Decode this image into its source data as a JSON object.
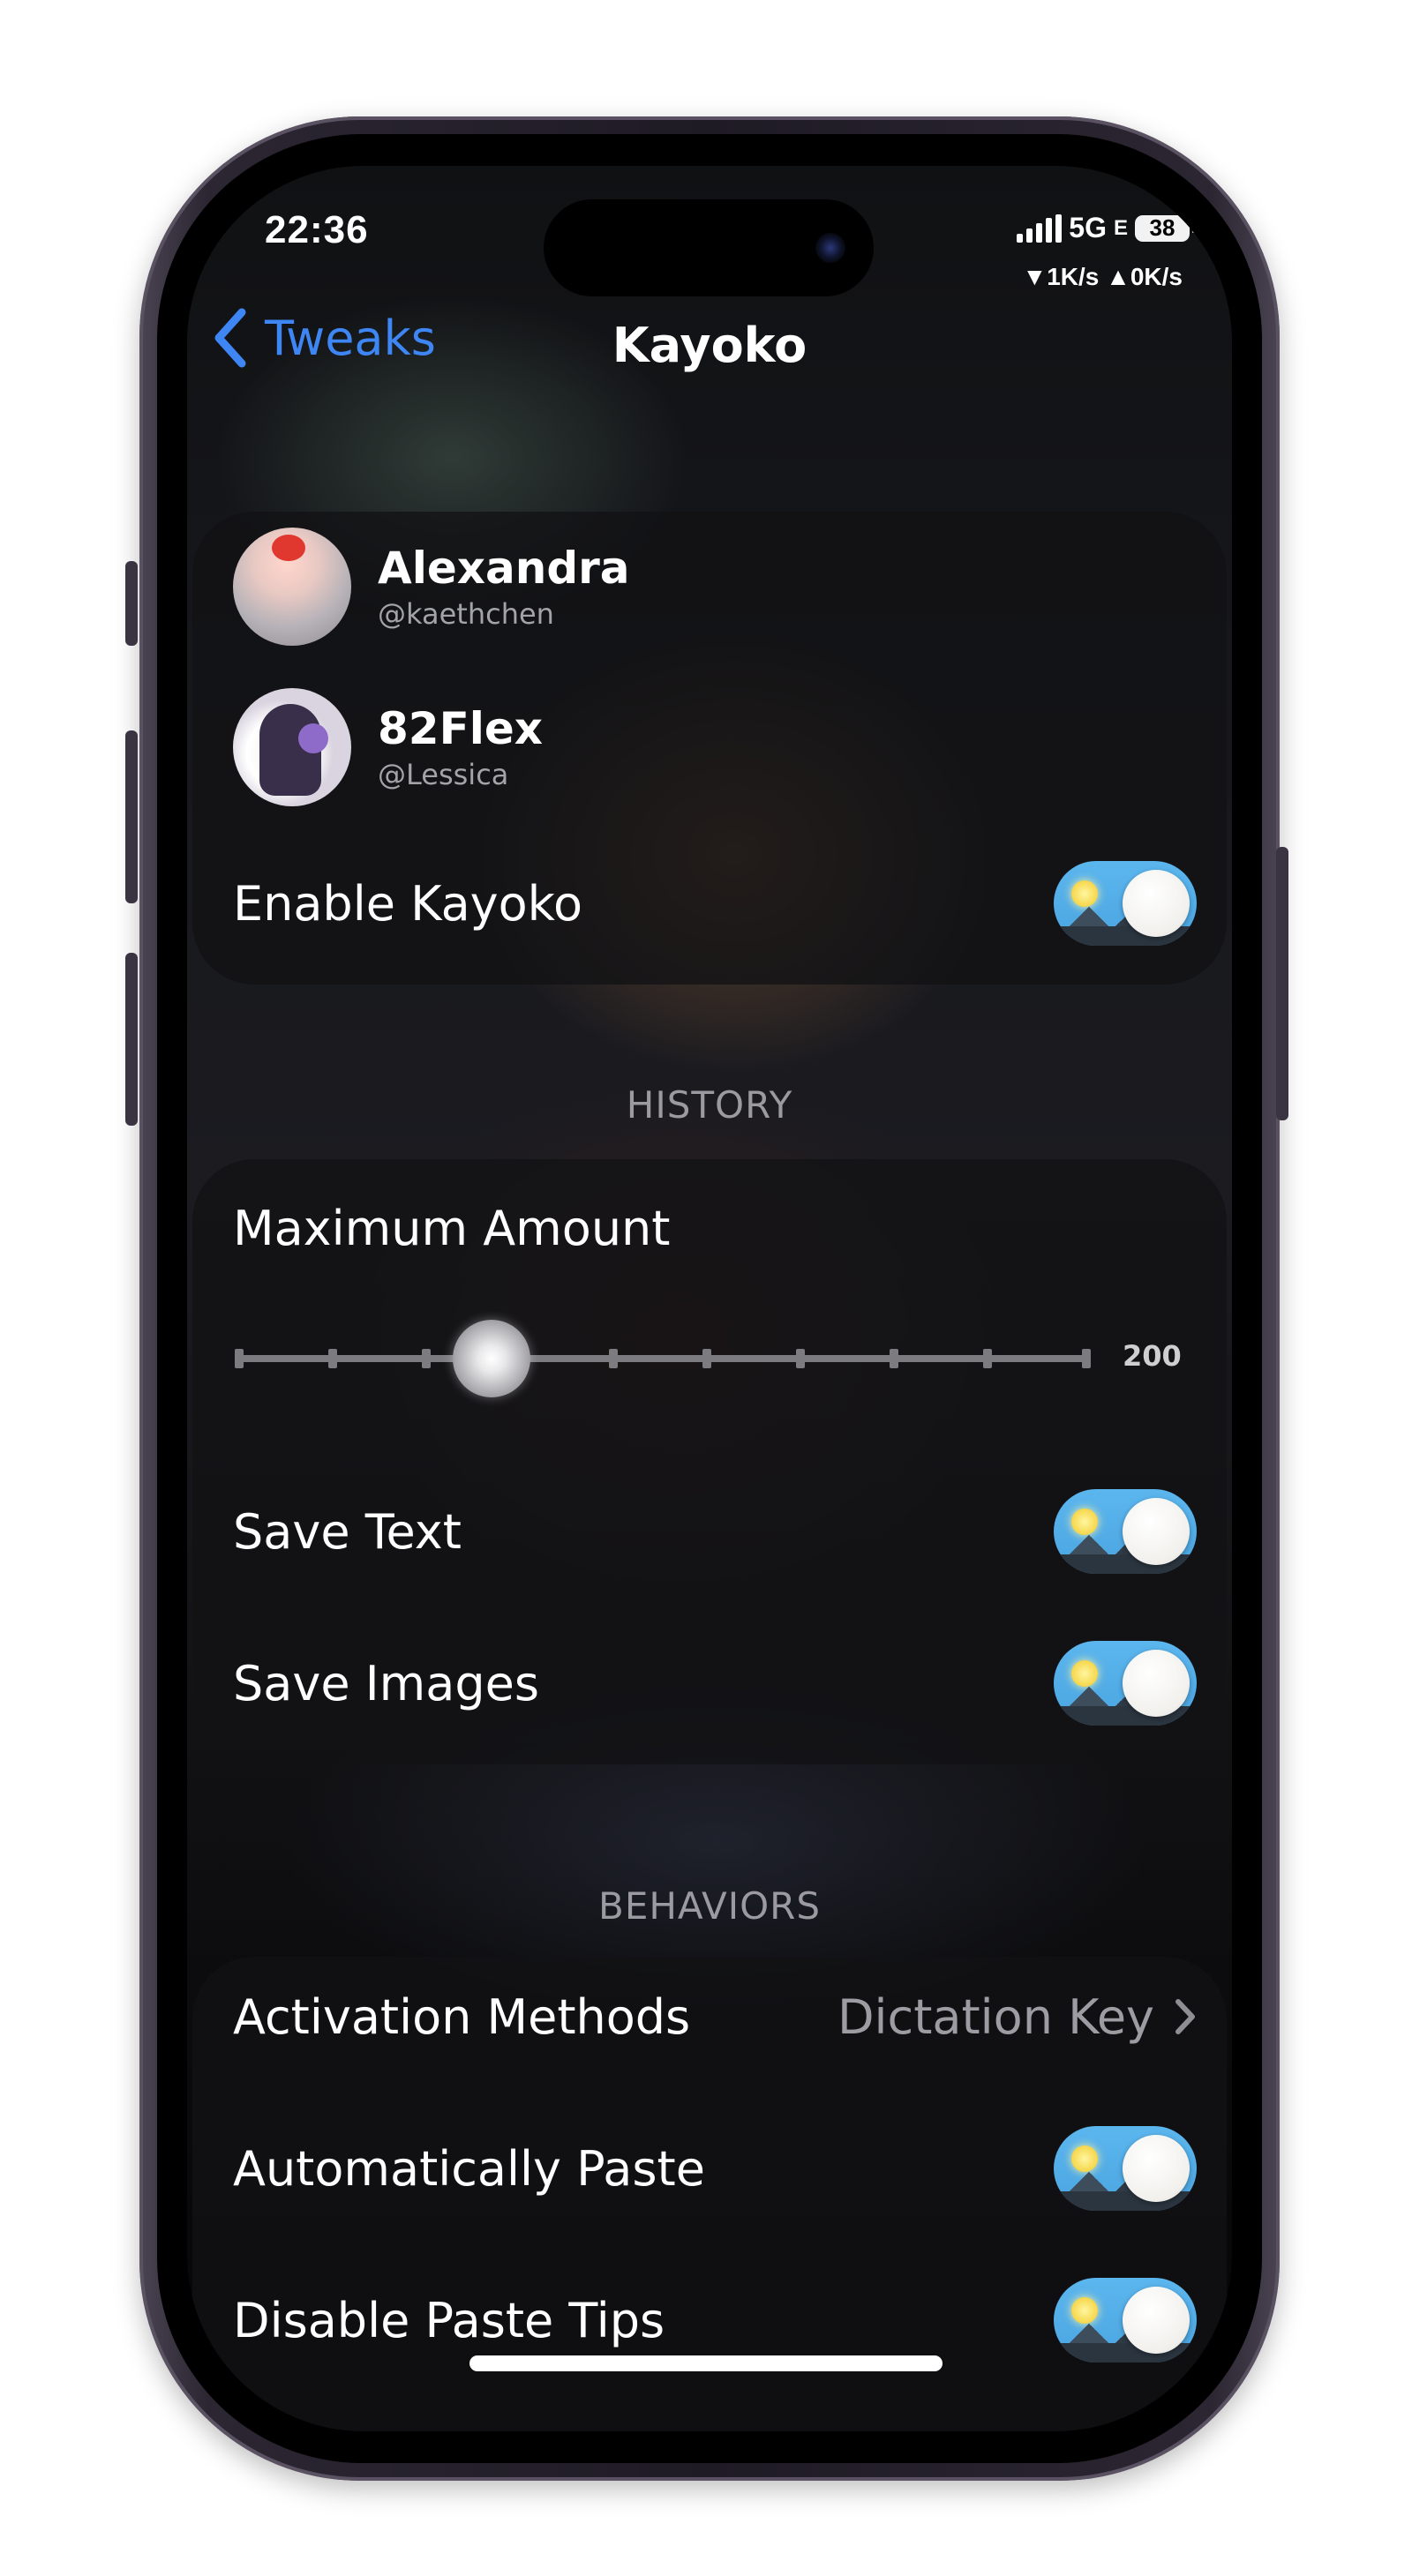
{
  "status_bar": {
    "time": "22:36",
    "network": "5G",
    "network_suffix": "E",
    "battery": "38",
    "net_speed": "▼1K/s ▲0K/s"
  },
  "nav": {
    "back_label": "Tweaks",
    "title": "Kayoko"
  },
  "credits": [
    {
      "name": "Alexandra",
      "handle": "@kaethchen"
    },
    {
      "name": "82Flex",
      "handle": "@Lessica"
    }
  ],
  "main": {
    "enable_label": "Enable Kayoko",
    "enable_on": true
  },
  "history": {
    "header": "HISTORY",
    "max_amount_label": "Maximum Amount",
    "slider_value_text": "200.",
    "slider_fraction": 0.3,
    "save_text_label": "Save Text",
    "save_text_on": true,
    "save_images_label": "Save Images",
    "save_images_on": true
  },
  "behaviors": {
    "header": "BEHAVIORS",
    "activation_label": "Activation Methods",
    "activation_value": "Dictation Key",
    "auto_paste_label": "Automatically Paste",
    "auto_paste_on": true,
    "disable_tips_label": "Disable Paste Tips",
    "disable_tips_on": true
  },
  "colors": {
    "accent": "#3f86f5",
    "toggle_sky": "#5cb6ee"
  }
}
